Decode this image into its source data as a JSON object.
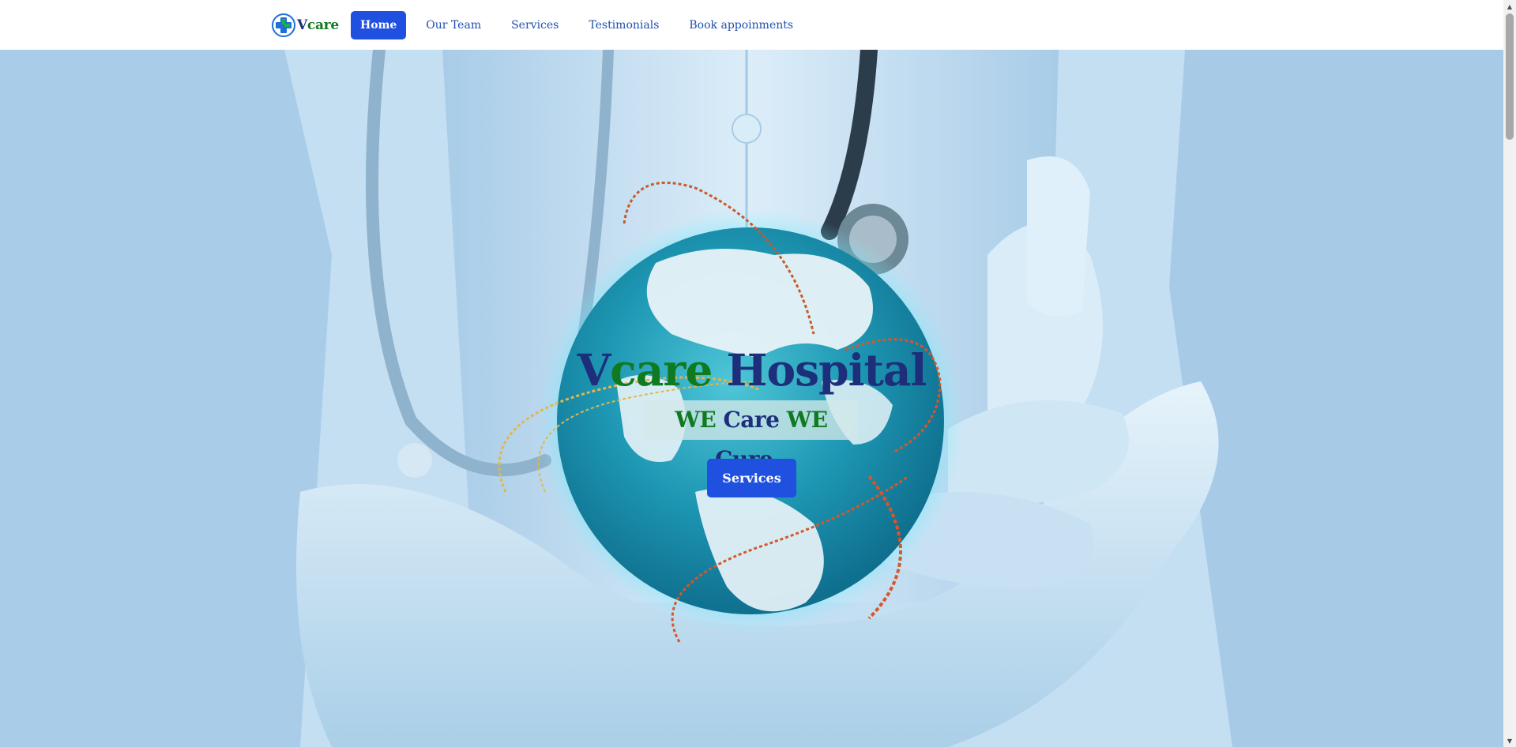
{
  "brand": {
    "name_v": "V",
    "name_care": "care"
  },
  "nav": {
    "items": [
      {
        "label": "Home",
        "active": true
      },
      {
        "label": "Our Team",
        "active": false
      },
      {
        "label": "Services",
        "active": false
      },
      {
        "label": "Testimonials",
        "active": false
      },
      {
        "label": "Book appoinments",
        "active": false
      }
    ]
  },
  "hero": {
    "title_v": "V",
    "title_care": "care",
    "title_hospital": " Hospital",
    "tagline": {
      "we1": "WE",
      "care": "Care",
      "we2": "WE",
      "cure": "Cure",
      "dots": ".."
    },
    "button_label": "Services"
  },
  "colors": {
    "primary": "#1f50e0",
    "brand_navy": "#1d2f7a",
    "brand_green": "#0f7a1f",
    "nav_link": "#1f4fb0"
  },
  "icons": {
    "logo": "medical-cross-icon",
    "scroll_up": "triangle-up-icon",
    "scroll_down": "triangle-down-icon"
  }
}
